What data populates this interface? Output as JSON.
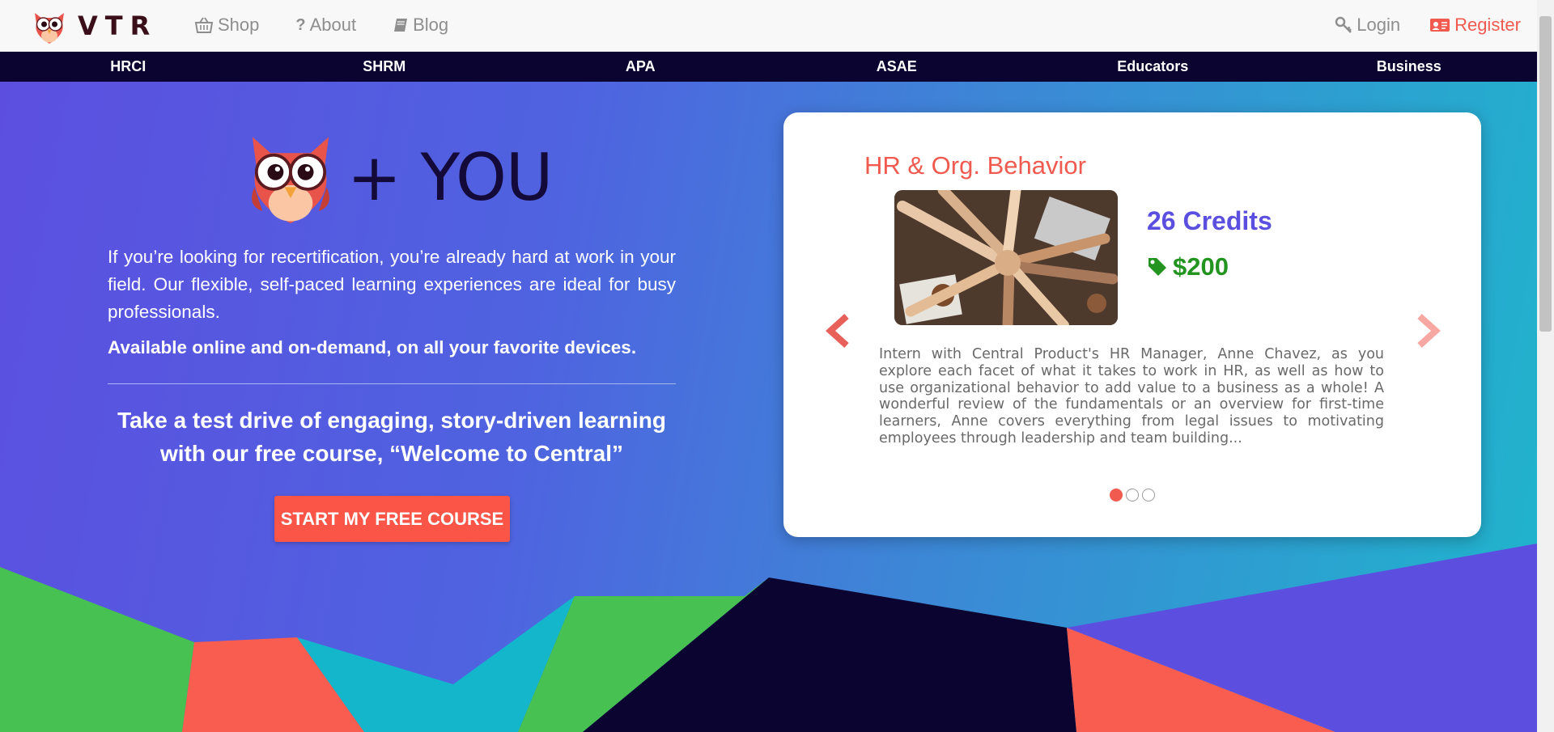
{
  "header": {
    "logo_text": "VTR",
    "nav_left": [
      {
        "label": "Shop",
        "icon": "basket-icon"
      },
      {
        "label": "About",
        "icon": "question-icon"
      },
      {
        "label": "Blog",
        "icon": "book-icon"
      }
    ],
    "login": {
      "label": "Login",
      "icon": "key-icon"
    },
    "register": {
      "label": "Register",
      "icon": "id-card-icon"
    }
  },
  "certifications": [
    "HRCI",
    "SHRM",
    "APA",
    "ASAE",
    "Educators",
    "Business"
  ],
  "hero": {
    "headline": "+ YOU",
    "paragraph": "If you’re looking for recertification, you’re already hard at work in your field. Our flexible, self-paced learning experiences are ideal for busy professionals.",
    "paragraph_bold": "Available online and on-demand, on all your favorite devices.",
    "cta_text": "Take a test drive of engaging, story-driven learning with our free course, “Welcome to Central”",
    "cta_button": "START MY FREE COURSE"
  },
  "carousel": {
    "title": "HR & Org. Behavior",
    "credits": "26 Credits",
    "price": "$200",
    "description": "Intern with Central Product's HR Manager, Anne Chavez, as you explore each facet of what it takes to work in HR, as well as how to use organizational behavior to add value to a business as a whole! A wonderful review of the fundamentals or an overview for first-time learners, Anne covers everything from legal issues to motivating employees through leadership and team building...",
    "slides": 3,
    "active_slide": 1
  },
  "colors": {
    "accent": "#f05a4f",
    "navy": "#0c0430",
    "purple": "#5b4fe0",
    "green": "#23941f"
  }
}
